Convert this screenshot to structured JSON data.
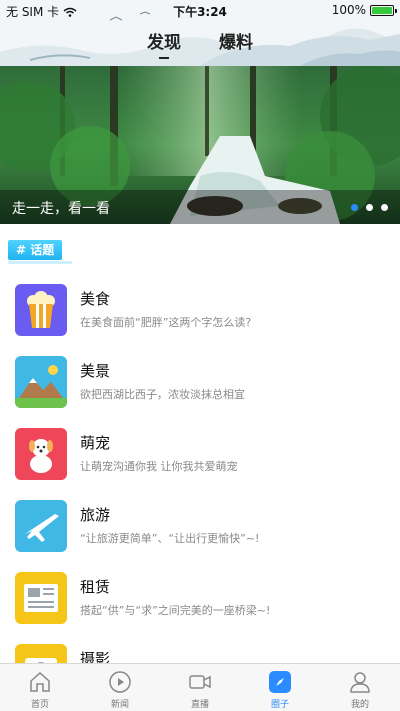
{
  "status_bar": {
    "carrier": "无 SIM 卡",
    "time": "下午3:24",
    "battery": "100%",
    "battery_level": 1.0
  },
  "header": {
    "tabs": [
      {
        "label": "发现",
        "active": true
      },
      {
        "label": "爆料",
        "active": false
      }
    ]
  },
  "banner": {
    "caption": "走一走，看一看",
    "page_count": 3,
    "active_index": 0
  },
  "topics": {
    "badge": "# 话题",
    "items": [
      {
        "title": "美食",
        "desc": "在美食面前“肥胖”这两个字怎么读?",
        "icon": "popcorn-icon",
        "color": "#6a5cf0"
      },
      {
        "title": "美景",
        "desc": "欲把西湖比西子，浓妆淡抹总相宜",
        "icon": "landscape-icon",
        "color": "#3fb8e6"
      },
      {
        "title": "萌宠",
        "desc": "让萌宠沟通你我 让你我共爱萌宠",
        "icon": "dog-icon",
        "color": "#f0465a"
      },
      {
        "title": "旅游",
        "desc": "“让旅游更简单”、“让出行更愉快”~!",
        "icon": "airplane-icon",
        "color": "#3fb8e6"
      },
      {
        "title": "租赁",
        "desc": "搭起“供”与“求”之间完美的一座桥梁~!",
        "icon": "newspaper-icon",
        "color": "#f5c518"
      },
      {
        "title": "摄影",
        "desc": "",
        "icon": "camera-icon",
        "color": "#f5c518"
      }
    ]
  },
  "bottom_nav": {
    "items": [
      {
        "label": "首页",
        "icon": "home-icon",
        "active": false
      },
      {
        "label": "新闻",
        "icon": "play-circle-icon",
        "active": false
      },
      {
        "label": "直播",
        "icon": "video-camera-icon",
        "active": false
      },
      {
        "label": "圈子",
        "icon": "compass-icon",
        "active": true
      },
      {
        "label": "我的",
        "icon": "user-icon",
        "active": false
      }
    ]
  }
}
